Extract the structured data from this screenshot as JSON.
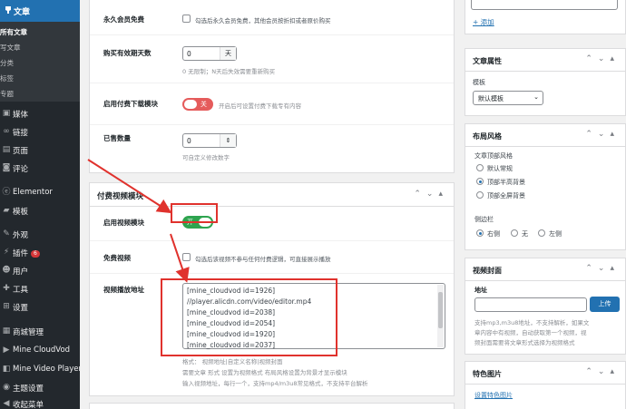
{
  "sidebar": {
    "current": "文章",
    "sub_items": [
      "所有文章",
      "写文章",
      "分类",
      "标签",
      "专题"
    ],
    "items": [
      {
        "icon": "media-icon",
        "label": "媒体"
      },
      {
        "icon": "link-icon",
        "label": "链接"
      },
      {
        "icon": "page-icon",
        "label": "页面"
      },
      {
        "icon": "comment-icon",
        "label": "评论"
      },
      {
        "icon": "elementor-icon",
        "label": "Elementor"
      },
      {
        "icon": "template-icon",
        "label": "模板"
      },
      {
        "icon": "appearance-icon",
        "label": "外观"
      },
      {
        "icon": "plugin-icon",
        "label": "插件",
        "badge": "6"
      },
      {
        "icon": "user-icon",
        "label": "用户"
      },
      {
        "icon": "tools-icon",
        "label": "工具"
      },
      {
        "icon": "settings-icon",
        "label": "设置"
      },
      {
        "icon": "shop-icon",
        "label": "商城管理"
      },
      {
        "icon": "cloudvod-icon",
        "label": "Mine CloudVod"
      },
      {
        "icon": "video-player-icon",
        "label": "Mine Video Player"
      },
      {
        "icon": "theme-icon",
        "label": "主题设置"
      },
      {
        "icon": "collapse-icon",
        "label": "收起菜单"
      }
    ]
  },
  "main": {
    "fields": {
      "permanent_member": {
        "label": "永久会员免费",
        "hint": "勾选后永久会员免费，其他会员按折扣或者原价购买"
      },
      "valid_days": {
        "label": "购买有效期天数",
        "value": "0",
        "unit": "天",
        "hint": "0 无限制；N天后失效需要重新购买"
      },
      "download": {
        "label": "启用付费下载模块",
        "toggle": "关",
        "hint": "开启后可设置付费下载专有内容"
      },
      "sold_count": {
        "label": "已售数量",
        "value": "0",
        "hint": "可自定义修改数字"
      }
    },
    "video_box": {
      "title": "付费视频模块",
      "enable": {
        "label": "启用视频模块",
        "toggle": "开"
      },
      "free": {
        "label": "免费视频",
        "hint": "勾选后该视频不参与任何付费逻辑，可直接展示播放"
      },
      "urls": {
        "label": "视频播放地址",
        "lines": [
          "[mine_cloudvod id=1926]",
          "//player.alicdn.com/video/editor.mp4",
          "[mine_cloudvod id=2038]",
          "[mine_cloudvod id=2054]",
          "[mine_cloudvod id=1920]",
          "[mine_cloudvod id=2037]"
        ],
        "help": [
          "格式：    视频地址|自定义名称|视频封面",
          "需要文章 形式 设置为视频格式 布局风格设置为背景才显示模块",
          "输入视频地址，每行一个，支持mp4/m3u8常见格式，不支持平台解析"
        ]
      }
    }
  },
  "right": {
    "add_link": "+ 添加",
    "attributes": {
      "title": "文章属性",
      "template_label": "模板",
      "template_value": "默认模板"
    },
    "layout": {
      "title": "布局风格",
      "header_label": "文章顶部风格",
      "header_options": [
        "默认常规",
        "顶部半高背景",
        "顶部全屏背景"
      ],
      "header_selected": 1,
      "sidebar_label": "侧边栏",
      "sidebar_options": [
        "右侧",
        "无",
        "左侧"
      ],
      "sidebar_selected": 0
    },
    "cover": {
      "title": "视频封面",
      "addr_label": "地址",
      "upload": "上传",
      "hint": [
        "支持mp3,m3u8地址，不支持解析，如果文",
        "章内容中有视频，自动获取第一个视频，视",
        "频封面需要将文章形式选择为视频格式"
      ]
    },
    "featured": {
      "title": "特色图片",
      "link": "设置特色图片"
    }
  },
  "colors": {
    "accent": "#2271b1",
    "toggle_on": "#2ea44f",
    "toggle_off": "#e55b5b",
    "annotation": "#e0322d",
    "sidebar_bg": "#23282d"
  }
}
